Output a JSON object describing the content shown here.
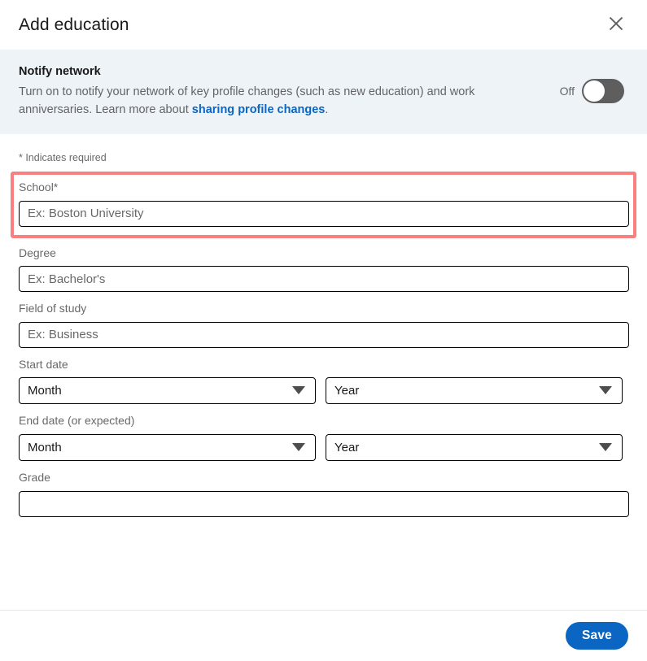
{
  "header": {
    "title": "Add education",
    "close_icon": "close-icon"
  },
  "notify": {
    "title": "Notify network",
    "description_before_link": "Turn on to notify your network of key profile changes (such as new education) and work anniversaries. Learn more about ",
    "link_text": "sharing profile changes",
    "description_after_link": ".",
    "toggle_state_label": "Off",
    "toggle_on": false
  },
  "form": {
    "required_note": "* Indicates required",
    "fields": {
      "school": {
        "label": "School*",
        "placeholder": "Ex: Boston University",
        "value": "",
        "highlighted": true
      },
      "degree": {
        "label": "Degree",
        "placeholder": "Ex: Bachelor's",
        "value": ""
      },
      "field_of_study": {
        "label": "Field of study",
        "placeholder": "Ex: Business",
        "value": ""
      },
      "start_date": {
        "label": "Start date",
        "month_value": "Month",
        "year_value": "Year"
      },
      "end_date": {
        "label": "End date (or expected)",
        "month_value": "Month",
        "year_value": "Year"
      },
      "grade": {
        "label": "Grade",
        "placeholder": "",
        "value": ""
      }
    }
  },
  "footer": {
    "save_label": "Save"
  },
  "colors": {
    "accent_blue": "#0a66c2",
    "notify_band_bg": "#eef3f8",
    "highlight_border": "#f98080",
    "toggle_track_off": "#5e5e5e"
  }
}
